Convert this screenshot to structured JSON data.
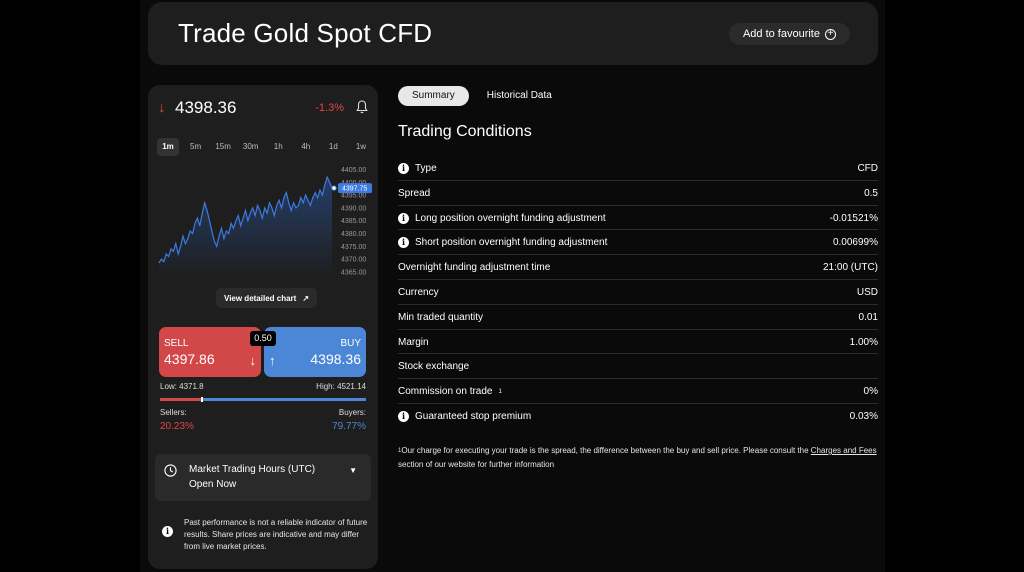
{
  "header": {
    "title": "Trade Gold Spot CFD",
    "favourite_label": "Add to favourite"
  },
  "quote": {
    "price": "4398.36",
    "change_pct": "-1.3%",
    "direction": "down"
  },
  "timeframes": [
    "1m",
    "5m",
    "15m",
    "30m",
    "1h",
    "4h",
    "1d",
    "1w"
  ],
  "active_timeframe": "1m",
  "chart_data": {
    "type": "line",
    "y_ticks": [
      "4405.00",
      "4400.00",
      "4395.00",
      "4390.00",
      "4385.00",
      "4380.00",
      "4375.00",
      "4370.00",
      "4365.00"
    ],
    "ylim": [
      4363,
      4406
    ],
    "current_label": "4397.75",
    "values": [
      4368.5,
      4370,
      4369,
      4372,
      4371,
      4374,
      4373,
      4376,
      4372,
      4375,
      4379,
      4376,
      4378,
      4381,
      4380,
      4384,
      4386,
      4383,
      4388,
      4392,
      4389,
      4385,
      4381,
      4377,
      4375,
      4379,
      4382,
      4378,
      4381,
      4380,
      4384,
      4382,
      4385,
      4387,
      4383,
      4386,
      4389,
      4385,
      4388,
      4390,
      4387,
      4391,
      4389,
      4386,
      4390,
      4388,
      4392,
      4390,
      4387,
      4391,
      4393,
      4390,
      4394,
      4396,
      4392,
      4389,
      4392,
      4390,
      4391,
      4394,
      4392,
      4395,
      4393,
      4391,
      4394,
      4396,
      4394,
      4397,
      4395,
      4399,
      4402,
      4400,
      4397.75
    ]
  },
  "view_chart_label": "View detailed chart",
  "sell": {
    "label": "SELL",
    "price": "4397.86"
  },
  "buy": {
    "label": "BUY",
    "price": "4398.36"
  },
  "spread_badge": "0.50",
  "low": "Low: 4371.8",
  "high": "High: 4521.14",
  "sentiment": {
    "sellers_label": "Sellers:",
    "sellers_value": "20.23%",
    "buyers_label": "Buyers:",
    "buyers_value": "79.77%",
    "sellers_fraction": 0.2023
  },
  "hours": {
    "title": "Market Trading Hours (UTC)",
    "status": "Open Now"
  },
  "disclaimer": "Past performance is not a reliable indicator of future results. Share prices are indicative and may differ from live market prices.",
  "tabs": [
    {
      "label": "Summary"
    },
    {
      "label": "Historical Data"
    }
  ],
  "section_title": "Trading Conditions",
  "conditions": [
    {
      "label": "Type",
      "value": "CFD",
      "info": true
    },
    {
      "label": "Spread",
      "value": "0.5",
      "info": false
    },
    {
      "label": "Long position overnight funding adjustment",
      "value": "-0.01521%",
      "info": true
    },
    {
      "label": "Short position overnight funding adjustment",
      "value": "0.00699%",
      "info": true
    },
    {
      "label": "Overnight funding adjustment time",
      "value": "21:00 (UTC)",
      "info": false
    },
    {
      "label": "Currency",
      "value": "USD",
      "info": false
    },
    {
      "label": "Min traded quantity",
      "value": "0.01",
      "info": false
    },
    {
      "label": "Margin",
      "value": "1.00%",
      "info": false
    },
    {
      "label": "Stock exchange",
      "value": "",
      "info": false
    },
    {
      "label": "Commission on trade",
      "value": "0%",
      "info": false,
      "sup": "1"
    },
    {
      "label": "Guaranteed stop premium",
      "value": "0.03%",
      "info": true
    }
  ],
  "footnote": {
    "sup": "1",
    "text": "Our charge for executing your trade is the spread, the difference between the buy and sell price. Please consult the ",
    "link": "Charges and Fees",
    "text_after": " section of our website for further information"
  }
}
